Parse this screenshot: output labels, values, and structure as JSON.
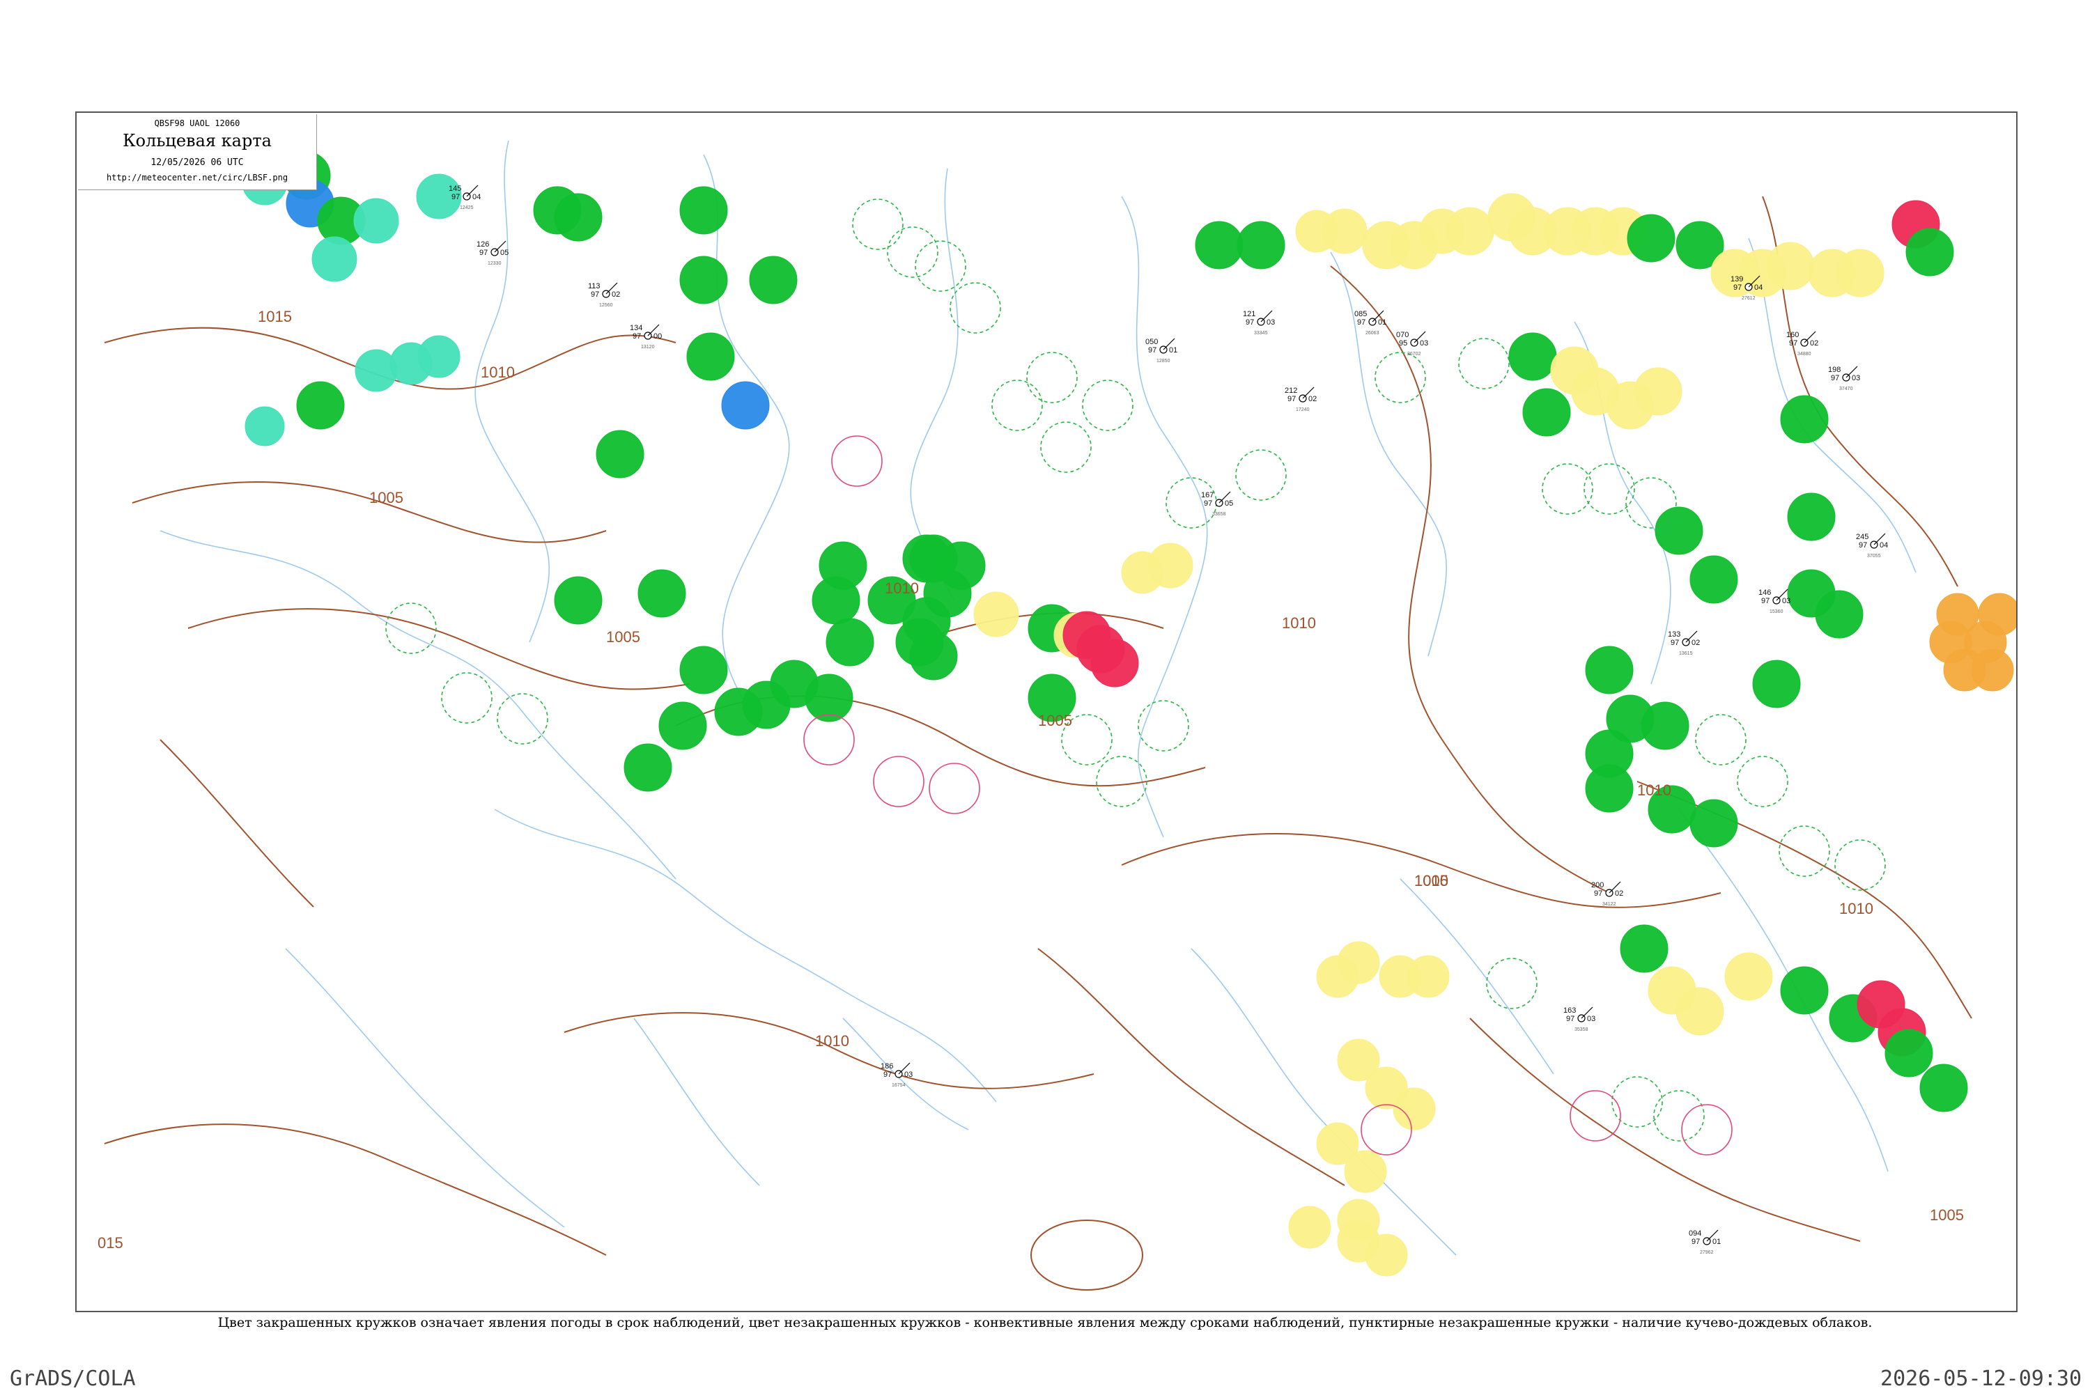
{
  "header": {
    "bulletin_code": "QBSF98  UAOL  12060",
    "map_title": "Кольцевая карта",
    "obs_time": "12/05/2026 06 UTC",
    "source_url": "http://meteocenter.net/circ/LBSF.png"
  },
  "caption": "Цвет закрашенных кружков означает явления погоды в срок наблюдений, цвет незакрашенных кружков - конвективные явления между сроками наблюдений, пунктирные незакрашенные кружки - наличие кучево-дождевых облаков.",
  "footer": {
    "software": "GrADS/COLA",
    "render_time": "2026-05-12-09:30"
  },
  "colors": {
    "isobar": "#a0522d",
    "river": "#9ec9ee",
    "rain": "#0fbf2e",
    "shower_light": "#44e0b8",
    "drizzle": "#2a8ae8",
    "fog": "#fbf089",
    "thunder": "#ee2a55",
    "haze": "#f4a93b",
    "cb_dashed": "#2fb34a",
    "thunder_ring": "#e04a7a"
  },
  "isobars": [
    {
      "label": "1015"
    },
    {
      "label": "1010"
    },
    {
      "label": "1005"
    },
    {
      "label": "1005"
    },
    {
      "label": "1010"
    },
    {
      "label": "1005"
    },
    {
      "label": "1010"
    },
    {
      "label": "1010"
    },
    {
      "label": "1005"
    },
    {
      "label": "1010"
    },
    {
      "label": "1010"
    },
    {
      "label": "1005"
    },
    {
      "label": "1010"
    },
    {
      "label": "015"
    }
  ],
  "stations": [
    {
      "p": "145",
      "t": "97",
      "d": "04",
      "name": "12425"
    },
    {
      "p": "126",
      "t": "97",
      "d": "05",
      "name": "12330"
    },
    {
      "p": "113",
      "t": "97",
      "d": "02",
      "name": "12560"
    },
    {
      "p": "134",
      "t": "97",
      "d": "00",
      "name": "13120"
    },
    {
      "p": "050",
      "t": "97",
      "d": "01",
      "name": "12850"
    },
    {
      "p": "121",
      "t": "97",
      "d": "03",
      "name": "33345"
    },
    {
      "p": "139",
      "t": "97",
      "d": "04",
      "name": "27612"
    },
    {
      "p": "160",
      "t": "97",
      "d": "02",
      "name": "34880"
    },
    {
      "p": "198",
      "t": "97",
      "d": "03",
      "name": "37470"
    },
    {
      "p": "212",
      "t": "97",
      "d": "02",
      "name": "17240"
    },
    {
      "p": "085",
      "t": "97",
      "d": "01",
      "name": "26063"
    },
    {
      "p": "070",
      "t": "95",
      "d": "03",
      "name": "26702"
    },
    {
      "p": "167",
      "t": "97",
      "d": "05",
      "name": "33658"
    },
    {
      "p": "245",
      "t": "97",
      "d": "04",
      "name": "37055"
    },
    {
      "p": "146",
      "t": "97",
      "d": "03",
      "name": "15360"
    },
    {
      "p": "133",
      "t": "97",
      "d": "02",
      "name": "13615"
    },
    {
      "p": "200",
      "t": "97",
      "d": "02",
      "name": "34122"
    },
    {
      "p": "186",
      "t": "97",
      "d": "03",
      "name": "16754"
    },
    {
      "p": "094",
      "t": "97",
      "d": "01",
      "name": "27962"
    },
    {
      "p": "163",
      "t": "97",
      "d": "03",
      "name": "35358"
    }
  ]
}
